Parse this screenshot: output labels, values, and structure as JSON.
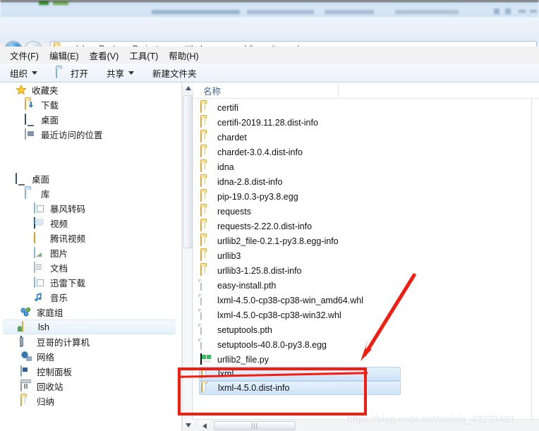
{
  "window": {
    "title_bar_blurred": true
  },
  "address_bar": {
    "back_icon": "back-arrow-icon",
    "forward_icon": "forward-arrow-icon",
    "history_icon": "chevron-down-icon",
    "root_icon": "folder-icon",
    "separator": "▸",
    "breadcrumbs": [
      "lsh",
      "PycharmProjects",
      "untitled",
      "venv",
      "Lib",
      "site-packages"
    ]
  },
  "menubar": {
    "items": [
      {
        "label": "文件(F)"
      },
      {
        "label": "编辑(E)"
      },
      {
        "label": "查看(V)"
      },
      {
        "label": "工具(T)"
      },
      {
        "label": "帮助(H)"
      }
    ]
  },
  "toolbar": {
    "organize_label": "组织",
    "open_label": "打开",
    "share_label": "共享",
    "new_folder_label": "新建文件夹"
  },
  "navpane": {
    "items": [
      {
        "label": "收藏夹",
        "icon": "star-icon",
        "indent": 0,
        "selected": false
      },
      {
        "label": "下载",
        "icon": "downloads-folder-icon",
        "indent": 1,
        "selected": false
      },
      {
        "label": "桌面",
        "icon": "desktop-icon",
        "indent": 1,
        "selected": false
      },
      {
        "label": "最近访问的位置",
        "icon": "recent-places-icon",
        "indent": 1,
        "selected": false
      },
      {
        "label": "",
        "icon": "spacer",
        "indent": 0,
        "selected": false
      },
      {
        "label": "桌面",
        "icon": "desktop-icon",
        "indent": 0,
        "selected": false
      },
      {
        "label": "库",
        "icon": "library-icon",
        "indent": 1,
        "selected": false
      },
      {
        "label": "暴风转码",
        "icon": "baofeng-transcode-icon",
        "indent": 2,
        "selected": false
      },
      {
        "label": "视频",
        "icon": "videos-icon",
        "indent": 2,
        "selected": false
      },
      {
        "label": "腾讯视频",
        "icon": "tencent-video-icon",
        "indent": 2,
        "selected": false
      },
      {
        "label": "图片",
        "icon": "pictures-icon",
        "indent": 2,
        "selected": false
      },
      {
        "label": "文档",
        "icon": "documents-icon",
        "indent": 2,
        "selected": false
      },
      {
        "label": "迅雷下载",
        "icon": "thunder-download-icon",
        "indent": 2,
        "selected": false
      },
      {
        "label": "音乐",
        "icon": "music-icon",
        "indent": 2,
        "selected": false
      },
      {
        "label": "家庭组",
        "icon": "homegroup-icon",
        "indent": 1,
        "selected": false
      },
      {
        "label": "lsh",
        "icon": "user-folder-icon",
        "indent": 1,
        "selected": true
      },
      {
        "label": "豆哥的计算机",
        "icon": "computer-icon",
        "indent": 1,
        "selected": false
      },
      {
        "label": "网络",
        "icon": "network-icon",
        "indent": 1,
        "selected": false
      },
      {
        "label": "控制面板",
        "icon": "control-panel-icon",
        "indent": 1,
        "selected": false
      },
      {
        "label": "回收站",
        "icon": "recycle-bin-icon",
        "indent": 1,
        "selected": false
      },
      {
        "label": "归纳",
        "icon": "folder-icon",
        "indent": 1,
        "selected": false
      }
    ]
  },
  "filelist": {
    "column_header": "名称",
    "rows": [
      {
        "name": "certifi",
        "icon": "folder-icon",
        "selected": false
      },
      {
        "name": "certifi-2019.11.28.dist-info",
        "icon": "folder-icon",
        "selected": false
      },
      {
        "name": "chardet",
        "icon": "folder-icon",
        "selected": false
      },
      {
        "name": "chardet-3.0.4.dist-info",
        "icon": "folder-icon",
        "selected": false
      },
      {
        "name": "idna",
        "icon": "folder-icon",
        "selected": false
      },
      {
        "name": "idna-2.8.dist-info",
        "icon": "folder-icon",
        "selected": false
      },
      {
        "name": "pip-19.0.3-py3.8.egg",
        "icon": "folder-icon",
        "selected": false
      },
      {
        "name": "requests",
        "icon": "folder-icon",
        "selected": false
      },
      {
        "name": "requests-2.22.0.dist-info",
        "icon": "folder-icon",
        "selected": false
      },
      {
        "name": "urllib2_file-0.2.1-py3.8.egg-info",
        "icon": "folder-icon",
        "selected": false
      },
      {
        "name": "urllib3",
        "icon": "folder-icon",
        "selected": false
      },
      {
        "name": "urllib3-1.25.8.dist-info",
        "icon": "folder-icon",
        "selected": false
      },
      {
        "name": "easy-install.pth",
        "icon": "file-icon",
        "selected": false
      },
      {
        "name": "lxml-4.5.0-cp38-cp38-win_amd64.whl",
        "icon": "file-icon",
        "selected": false
      },
      {
        "name": "lxml-4.5.0-cp38-cp38-win32.whl",
        "icon": "file-icon",
        "selected": false
      },
      {
        "name": "setuptools.pth",
        "icon": "file-icon",
        "selected": false
      },
      {
        "name": "setuptools-40.8.0-py3.8.egg",
        "icon": "file-icon",
        "selected": false
      },
      {
        "name": "urllib2_file.py",
        "icon": "python-file-icon",
        "selected": false
      },
      {
        "name": "lxml",
        "icon": "folder-icon",
        "selected": true
      },
      {
        "name": "lxml-4.5.0.dist-info",
        "icon": "folder-icon",
        "selected": true
      }
    ]
  },
  "annotation": {
    "highlight_color": "#f41b0f",
    "rect_targets": [
      "lxml",
      "lxml-4.5.0.dist-info"
    ],
    "arrow": "red-arrow-pointing-down-left"
  },
  "watermark": {
    "url": "https://blog.csdn.net/weixin_43233491"
  }
}
